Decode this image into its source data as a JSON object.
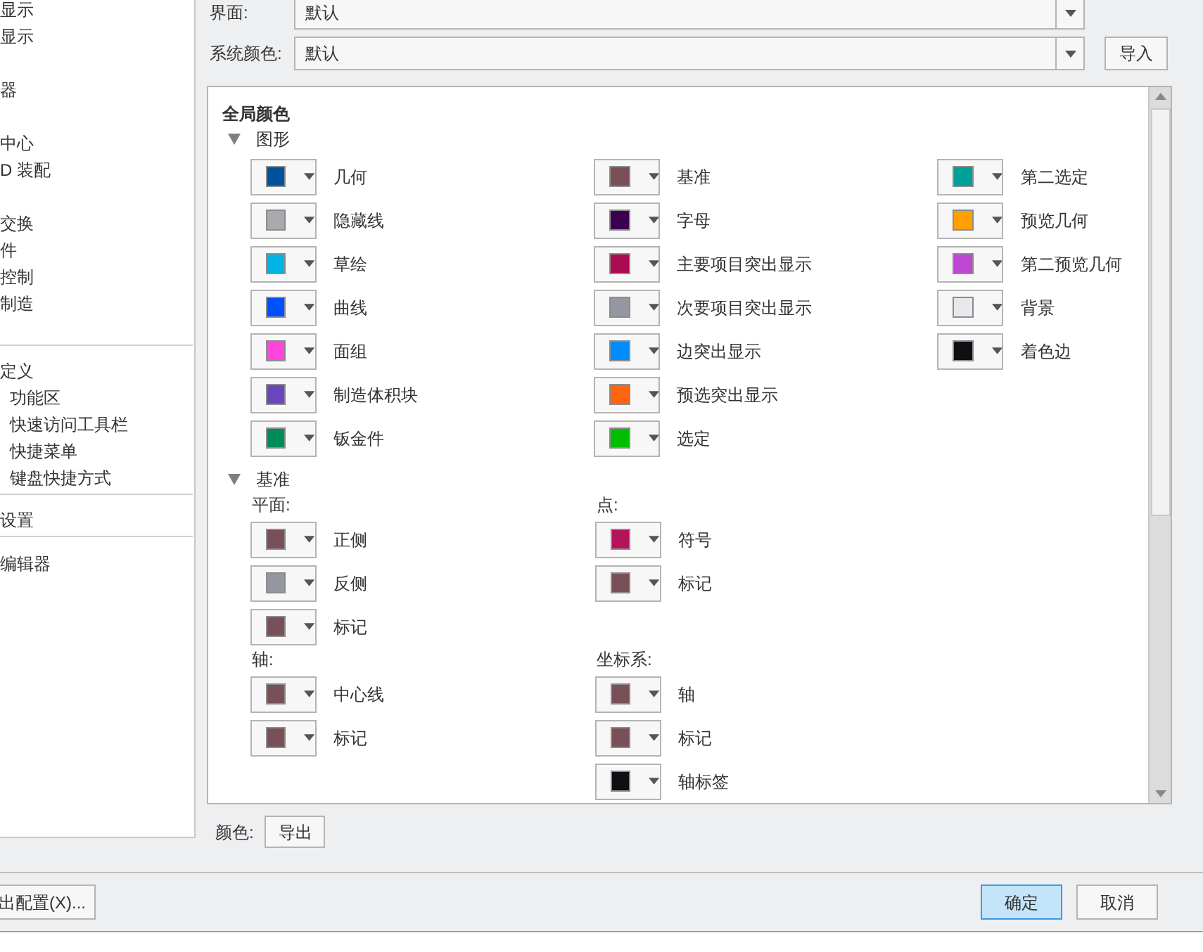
{
  "sidebar": {
    "groups": [
      {
        "kind": "spaced",
        "items": [
          {
            "label": "显示"
          },
          {
            "label": "显示"
          }
        ]
      },
      {
        "kind": "spaced",
        "items": [
          {
            "label": "器"
          }
        ]
      },
      {
        "kind": "spaced",
        "items": [
          {
            "label": "中心"
          },
          {
            "label": "D 装配"
          }
        ]
      },
      {
        "kind": "spaced",
        "items": [
          {
            "label": "交换"
          },
          {
            "label": "件"
          },
          {
            "label": "控制"
          },
          {
            "label": "制造"
          }
        ]
      },
      {
        "kind": "ruled",
        "items": [
          {
            "label": "定义",
            "children": [
              {
                "label": "功能区"
              },
              {
                "label": "快速访问工具栏"
              },
              {
                "label": "快捷菜单"
              },
              {
                "label": "键盘快捷方式"
              }
            ]
          }
        ]
      },
      {
        "kind": "ruled",
        "items": [
          {
            "label": "设置"
          }
        ]
      },
      {
        "kind": "ruled"
      },
      {
        "kind": "spaced",
        "items": [
          {
            "label": "编辑器"
          }
        ]
      }
    ]
  },
  "interface": {
    "label": "界面:",
    "value": "默认"
  },
  "system_color": {
    "label": "系统颜色:",
    "value": "默认",
    "button": "导入"
  },
  "panel": {
    "title": "全局颜色",
    "graphics": {
      "label": "图形",
      "expanded": true,
      "columns": [
        [
          {
            "label": "几何",
            "color": "#00509a"
          },
          {
            "label": "隐藏线",
            "color": "#a9a9ae"
          },
          {
            "label": "草绘",
            "color": "#00b4e6"
          },
          {
            "label": "曲线",
            "color": "#0050ff"
          },
          {
            "label": "面组",
            "color": "#ff46dc"
          },
          {
            "label": "制造体积块",
            "color": "#6a46be"
          },
          {
            "label": "钣金件",
            "color": "#008c5a"
          }
        ],
        [
          {
            "label": "基准",
            "color": "#7a5058"
          },
          {
            "label": "字母",
            "color": "#3c0050"
          },
          {
            "label": "主要项目突出显示",
            "color": "#aa0a50"
          },
          {
            "label": "次要项目突出显示",
            "color": "#9496a0"
          },
          {
            "label": "边突出显示",
            "color": "#008cff"
          },
          {
            "label": "预选突出显示",
            "color": "#ff6410"
          },
          {
            "label": "选定",
            "color": "#00be00"
          }
        ],
        [
          {
            "label": "第二选定",
            "color": "#00a096"
          },
          {
            "label": "预览几何",
            "color": "#ffa000"
          },
          {
            "label": "第二预览几何",
            "color": "#be46d2"
          },
          {
            "label": "背景",
            "color": "#e8e8ec"
          },
          {
            "label": "着色边",
            "color": "#101014"
          }
        ]
      ]
    },
    "datum": {
      "label": "基准",
      "expanded": true,
      "groups": [
        {
          "label": "平面:",
          "items": [
            {
              "label": "正侧",
              "color": "#7a5058"
            },
            {
              "label": "反侧",
              "color": "#9496a0"
            },
            {
              "label": "标记",
              "color": "#7a5058"
            }
          ]
        },
        {
          "label": "点:",
          "items": [
            {
              "label": "符号",
              "color": "#b4145a"
            },
            {
              "label": "标记",
              "color": "#7a5058"
            }
          ]
        },
        {
          "label": "轴:",
          "items": [
            {
              "label": "中心线",
              "color": "#7a5058"
            },
            {
              "label": "标记",
              "color": "#7a5058"
            }
          ]
        },
        {
          "label": "坐标系:",
          "items": [
            {
              "label": "轴",
              "color": "#7a5058"
            },
            {
              "label": "标记",
              "color": "#7a5058"
            },
            {
              "label": "轴标签",
              "color": "#101014"
            }
          ]
        }
      ]
    }
  },
  "color_export": {
    "label": "颜色:",
    "button": "导出"
  },
  "footer": {
    "export_config": "出配置(X)...",
    "ok": "确定",
    "cancel": "取消"
  }
}
